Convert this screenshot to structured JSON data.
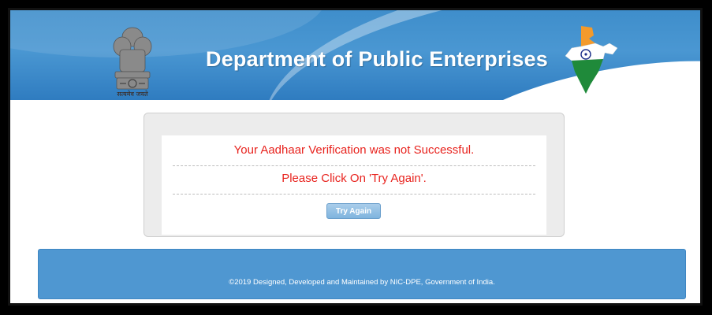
{
  "header": {
    "title": "Department of Public Enterprises",
    "emblem_caption": "सत्यमेव जयते",
    "icons": [
      "national-emblem-icon",
      "india-map-icon"
    ],
    "colors": {
      "header_blue": "#3f8ecb",
      "saffron": "#f39a2c",
      "green": "#1f8a3a"
    }
  },
  "panel": {
    "message_line1": "Your Aadhaar Verification was not Successful.",
    "message_line2": "Please Click On 'Try Again'.",
    "try_again_label": "Try Again",
    "colors": {
      "error_red": "#e8231e",
      "button_blue": "#7fb4de"
    }
  },
  "footer": {
    "text": "©2019 Designed, Developed and Maintained by NIC-DPE, Government of India.",
    "color": "#4f97d1"
  }
}
